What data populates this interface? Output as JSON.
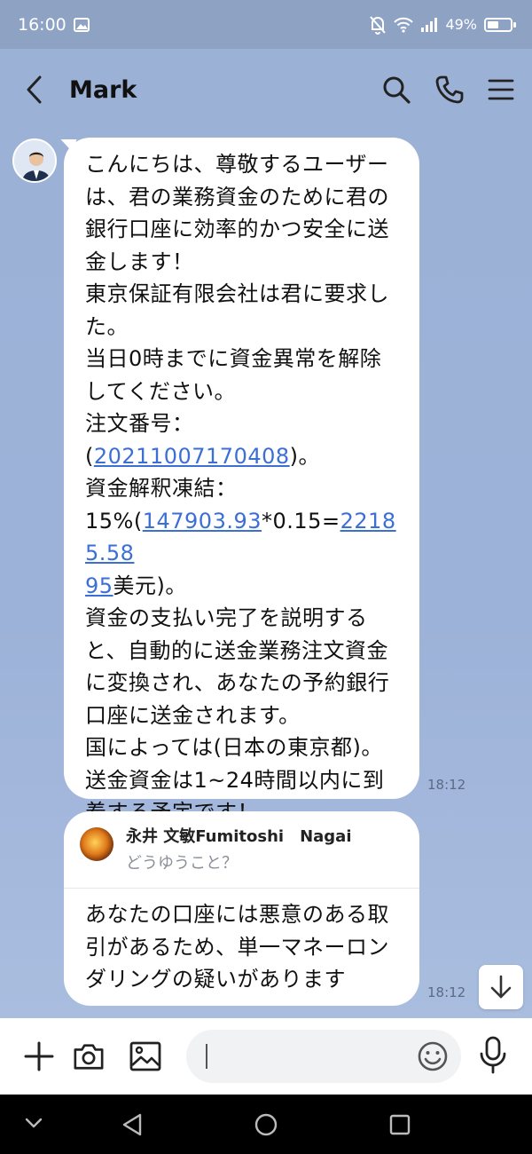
{
  "status": {
    "time": "16:00",
    "battery": "49%"
  },
  "header": {
    "title": "Mark"
  },
  "messages": {
    "first": {
      "lines": [
        "こんにちは、尊敬するユーザー",
        "は、君の業務資金のために君の",
        "銀行口座に効率的かつ安全に送",
        "金します！",
        "東京保証有限会社は君に要求し",
        "た。",
        "当日0時までに資金異常を解除",
        "してください。",
        "注文番号：",
        "(",
        "20211007170408",
        ")。",
        "資金解釈凍結：",
        "15%(",
        "147903.93",
        "*0.15=",
        "22185.58",
        "95",
        "美元)。",
        "資金の支払い完了を説明する",
        "と、自動的に送金業務注文資金",
        "に変換され、あなたの予約銀行",
        "口座に送金されます。",
        "国によっては(日本の東京都)。",
        "送金資金は1~24時間以内に到",
        "着する予定です！"
      ],
      "time": "18:12"
    },
    "second": {
      "reply_name": "永井 文敏Fumitoshi　Nagai",
      "reply_text": "どうゆうこと？",
      "lines": [
        "あなたの口座には悪意のある取",
        "引があるため、単一マネーロン",
        "ダリングの疑いがあります"
      ],
      "time": "18:12"
    }
  },
  "colors": {
    "link": "#3b6fd6",
    "chat_bg": "#9cb1d6"
  },
  "icons": [
    "back-icon",
    "search-icon",
    "phone-icon",
    "menu-icon",
    "plus-icon",
    "camera-icon",
    "image-icon",
    "emoji-icon",
    "mic-icon",
    "scroll-down-icon"
  ]
}
